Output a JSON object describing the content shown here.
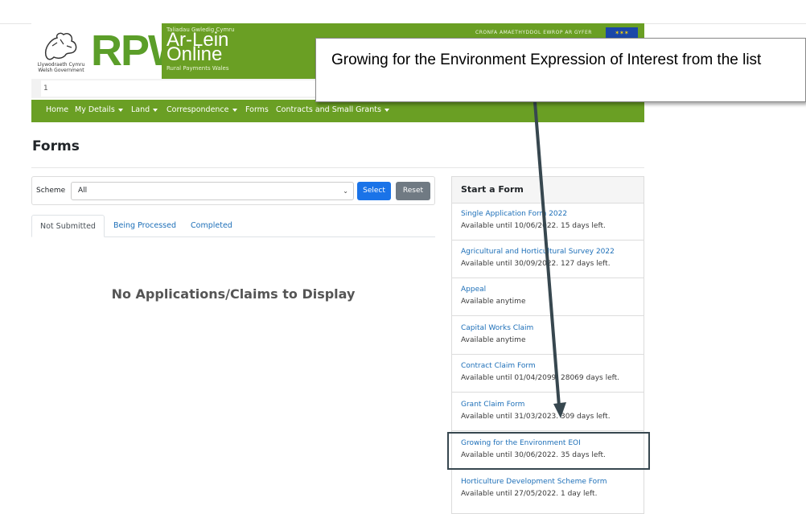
{
  "header": {
    "gov_text_welsh": "Llywodraeth Cymru",
    "gov_text_english": "Welsh Government",
    "brand": "RPW",
    "tagline_welsh": "Taliadau Gwledig Cymru",
    "product_line1": "Ar-Lein",
    "product_line2": "Online",
    "tagline_english": "Rural Payments Wales",
    "eafrd_text": "CRONFA AMAETHYDDOL EWROP AR GYFER",
    "search_value": "1"
  },
  "nav": {
    "items": [
      {
        "label": "Home",
        "dropdown": false
      },
      {
        "label": "My Details",
        "dropdown": true
      },
      {
        "label": "Land",
        "dropdown": true
      },
      {
        "label": "Correspondence",
        "dropdown": true
      },
      {
        "label": "Forms",
        "dropdown": false
      },
      {
        "label": "Contracts and Small Grants",
        "dropdown": true
      }
    ]
  },
  "page": {
    "title": "Forms",
    "empty_message": "No Applications/Claims to Display"
  },
  "filter": {
    "scheme_label": "Scheme",
    "scheme_value": "All",
    "select_label": "Select",
    "reset_label": "Reset"
  },
  "tabs": [
    {
      "label": "Not Submitted",
      "active": true
    },
    {
      "label": "Being Processed",
      "active": false
    },
    {
      "label": "Completed",
      "active": false
    }
  ],
  "start_form": {
    "title": "Start a Form",
    "items": [
      {
        "name": "Single Application Form 2022",
        "availability": "Available until 10/06/2022. 15 days left."
      },
      {
        "name": "Agricultural and Horticultural Survey 2022",
        "availability": "Available until 30/09/2022. 127 days left."
      },
      {
        "name": "Appeal",
        "availability": "Available anytime"
      },
      {
        "name": "Capital Works Claim",
        "availability": "Available anytime"
      },
      {
        "name": "Contract Claim Form",
        "availability": "Available until 01/04/2099. 28069 days left."
      },
      {
        "name": "Grant Claim Form",
        "availability": "Available until 31/03/2023. 309 days left."
      },
      {
        "name": "Growing for the Environment EOI",
        "availability": "Available until 30/06/2022. 35 days left."
      },
      {
        "name": "Horticulture Development Scheme Form",
        "availability": "Available until 27/05/2022. 1 day left."
      }
    ]
  },
  "callout": {
    "text": "Growing for the Environment Expression of Interest from the list"
  },
  "colors": {
    "brand_green": "#6a9f24",
    "link_blue": "#1d6fb8",
    "primary_button": "#1a73e8",
    "secondary_button": "#707a83",
    "highlight_border": "#37474f"
  }
}
